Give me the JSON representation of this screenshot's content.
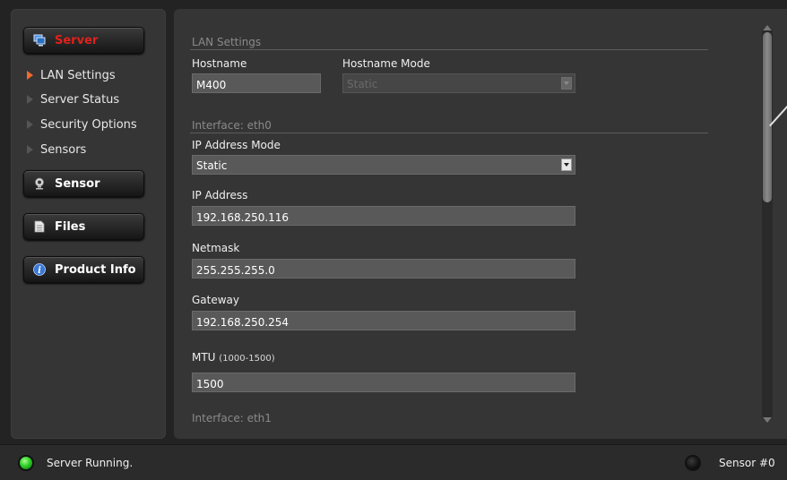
{
  "sidebar": {
    "buttons": {
      "server": "Server",
      "sensor": "Sensor",
      "files": "Files",
      "product_info": "Product Info"
    },
    "server_items": [
      {
        "label": "LAN Settings",
        "active": true
      },
      {
        "label": "Server Status",
        "active": false
      },
      {
        "label": "Security Options",
        "active": false
      },
      {
        "label": "Sensors",
        "active": false
      }
    ]
  },
  "lan": {
    "section_title": "LAN Settings",
    "hostname_label": "Hostname",
    "hostname_value": "M400",
    "hostname_mode_label": "Hostname Mode",
    "hostname_mode_value": "Static"
  },
  "eth0": {
    "section_title": "Interface: eth0",
    "ip_mode_label": "IP Address Mode",
    "ip_mode_value": "Static",
    "ip_label": "IP Address",
    "ip_value": "192.168.250.116",
    "netmask_label": "Netmask",
    "netmask_value": "255.255.255.0",
    "gateway_label": "Gateway",
    "gateway_value": "192.168.250.254",
    "mtu_label": "MTU",
    "mtu_range": "(1000-1500)",
    "mtu_value": "1500"
  },
  "eth1": {
    "section_title": "Interface: eth1"
  },
  "status": {
    "server": "Server Running.",
    "sensor": "Sensor #0",
    "server_led_color": "#2fcf2a",
    "sensor_led_color": "#141414"
  },
  "colors": {
    "active_nav": "#e0211c",
    "active_arrow": "#f06a2a"
  }
}
